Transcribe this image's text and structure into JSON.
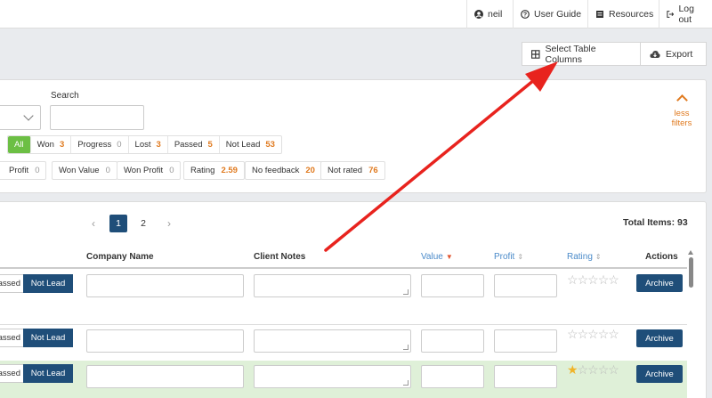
{
  "topnav": {
    "user": "neil",
    "guide": "User Guide",
    "resources": "Resources",
    "logout": "Log out"
  },
  "toolbar": {
    "select_columns": "Select Table Columns",
    "export": "Export"
  },
  "filters": {
    "search_label": "Search",
    "search_value": "",
    "status_pills": [
      {
        "label": "All",
        "count": ""
      },
      {
        "label": "Won",
        "count": "3"
      },
      {
        "label": "Progress",
        "count": "0"
      },
      {
        "label": "Lost",
        "count": "3"
      },
      {
        "label": "Passed",
        "count": "5"
      },
      {
        "label": "Not Lead",
        "count": "53"
      }
    ],
    "stats": [
      {
        "label": "Profit",
        "count": "0"
      },
      {
        "label": "Won Value",
        "count": "0"
      },
      {
        "label": "Won Profit",
        "count": "0"
      },
      {
        "label": "Rating",
        "count": "2.59"
      },
      {
        "label": "No feedback",
        "count": "20"
      },
      {
        "label": "Not rated",
        "count": "76"
      }
    ],
    "less_filters": "less filters"
  },
  "table": {
    "pages": [
      "1",
      "2"
    ],
    "prev": "‹",
    "next": "›",
    "total_items": "Total Items: 93",
    "columns": {
      "company": "Company Name",
      "notes": "Client Notes",
      "value": "Value",
      "profit": "Profit",
      "rating": "Rating",
      "actions": "Actions"
    },
    "rows": [
      {
        "passed": "assed",
        "not_lead": "Not Lead",
        "rating": 0,
        "action": "Archive"
      },
      {
        "passed": "assed",
        "not_lead": "Not Lead",
        "rating": 0,
        "action": "Archive"
      },
      {
        "passed": "assed",
        "not_lead": "Not Lead",
        "rating": 1,
        "action": "Archive"
      }
    ]
  },
  "colors": {
    "primary": "#1f4e79",
    "accent": "#e07a1f",
    "green": "#6cbf44",
    "annotation_arrow": "#e8231e"
  }
}
